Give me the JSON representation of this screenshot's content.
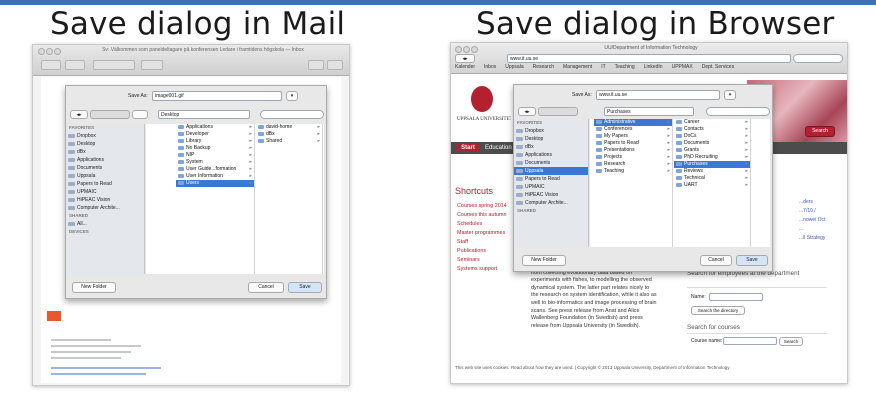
{
  "headings": {
    "mail": "Save dialog in Mail",
    "browser": "Save dialog in Browser"
  },
  "colors": {
    "accent_bar": "#3f6fb5",
    "selection": "#3a77d6",
    "uu_red": "#b3202f"
  },
  "mail": {
    "window_title": "Sv: Välkommen som paneldeltagare på konferensen Ledare i framtidens högskola — Inbox",
    "save_as_label": "Save As:",
    "save_as_value": "image001.gif",
    "location": "Desktop",
    "sidebar": {
      "favorites_header": "FAVORITES",
      "favorites": [
        "Dropbox",
        "Desktop",
        "dBx",
        "Applications",
        "Documents",
        "Uppsala",
        "Papers to Read",
        "UPMAIC",
        "HiPEAC Vision",
        "Computer Archite..."
      ],
      "shared_header": "SHARED",
      "shared": [
        "All..."
      ],
      "devices_header": "DEVICES"
    },
    "column1": [
      "Applications",
      "Developer",
      "Library",
      "No Backup",
      "NIP",
      "System",
      "User Guide...formation",
      "User Information",
      "Users"
    ],
    "column2": [
      "david-home",
      "dBx",
      "Shared"
    ],
    "new_folder": "New Folder",
    "cancel": "Cancel",
    "save": "Save"
  },
  "browser": {
    "window_title": "UU/Department of Information Technology",
    "url": "www.it.uu.se",
    "bookmarks": [
      "Kalender",
      "Inbox",
      "Uppsala",
      "Research",
      "Management",
      "IT",
      "Teaching",
      "LinkedIn",
      "UPPMAX",
      "Dept. Services"
    ],
    "university": "UPPSALA UNIVERSITET",
    "nav_tab_start": "Start",
    "nav_tab_education": "Education",
    "search_button": "Search",
    "save_as_label": "Save As:",
    "save_as_value": "www.it.uu.se",
    "location": "Purchases",
    "sidebar": {
      "favorites_header": "FAVORITES",
      "favorites": [
        "Dropbox",
        "Desktop",
        "dBx",
        "Applications",
        "Documents",
        "Uppsala",
        "Papers to Read",
        "UPMAIC",
        "HiPEAC Vision",
        "Computer Archite..."
      ],
      "shared_header": "SHARED"
    },
    "column1": [
      "Administrative",
      "Conferences",
      "My Papers",
      "Papers to Read",
      "Presentations",
      "Projects",
      "Research",
      "Teaching"
    ],
    "column2": [
      "Career",
      "Contacts",
      "DoCs",
      "Documents",
      "Grants",
      "PhD Recruiting",
      "Purchases",
      "Reviews",
      "Technical",
      "UART"
    ],
    "new_folder": "New Folder",
    "cancel": "Cancel",
    "save": "Save",
    "shortcuts_title": "Shortcuts",
    "shortcuts": [
      "Courses spring 2014",
      "Courses this autumn",
      "Schedules",
      "Master programmes",
      "Staff",
      "Publications",
      "Seminars",
      "Systems support"
    ],
    "body_text": "This project is truly interdisciplinary, as it ranges from collecting evolutionary data based on experiments with fishes, to modelling the observed dynamical system. The latter part relates nicely to the research on system identification, while it also as well to bio-informatics and image processing of brain scans. See press release from Anat and Alice Wallenberg Foundation (in Swedish) and press release from Uppsala University (in Swedish).",
    "employee_search_title": "Search for employees at the department",
    "name_label": "Name:",
    "search_directory": "Search the directory",
    "course_search_title": "Search for courses",
    "course_name_label": "Course name:",
    "course_search_btn": "Search",
    "footer": "This web site uses cookies. Read about how they are used. | Copyright © 2013 Uppsala University, Department of Information Technology",
    "right_links": [
      "...ders",
      "...7/10 /",
      "...nowei Oct",
      "...",
      "...ll Strategy"
    ]
  }
}
